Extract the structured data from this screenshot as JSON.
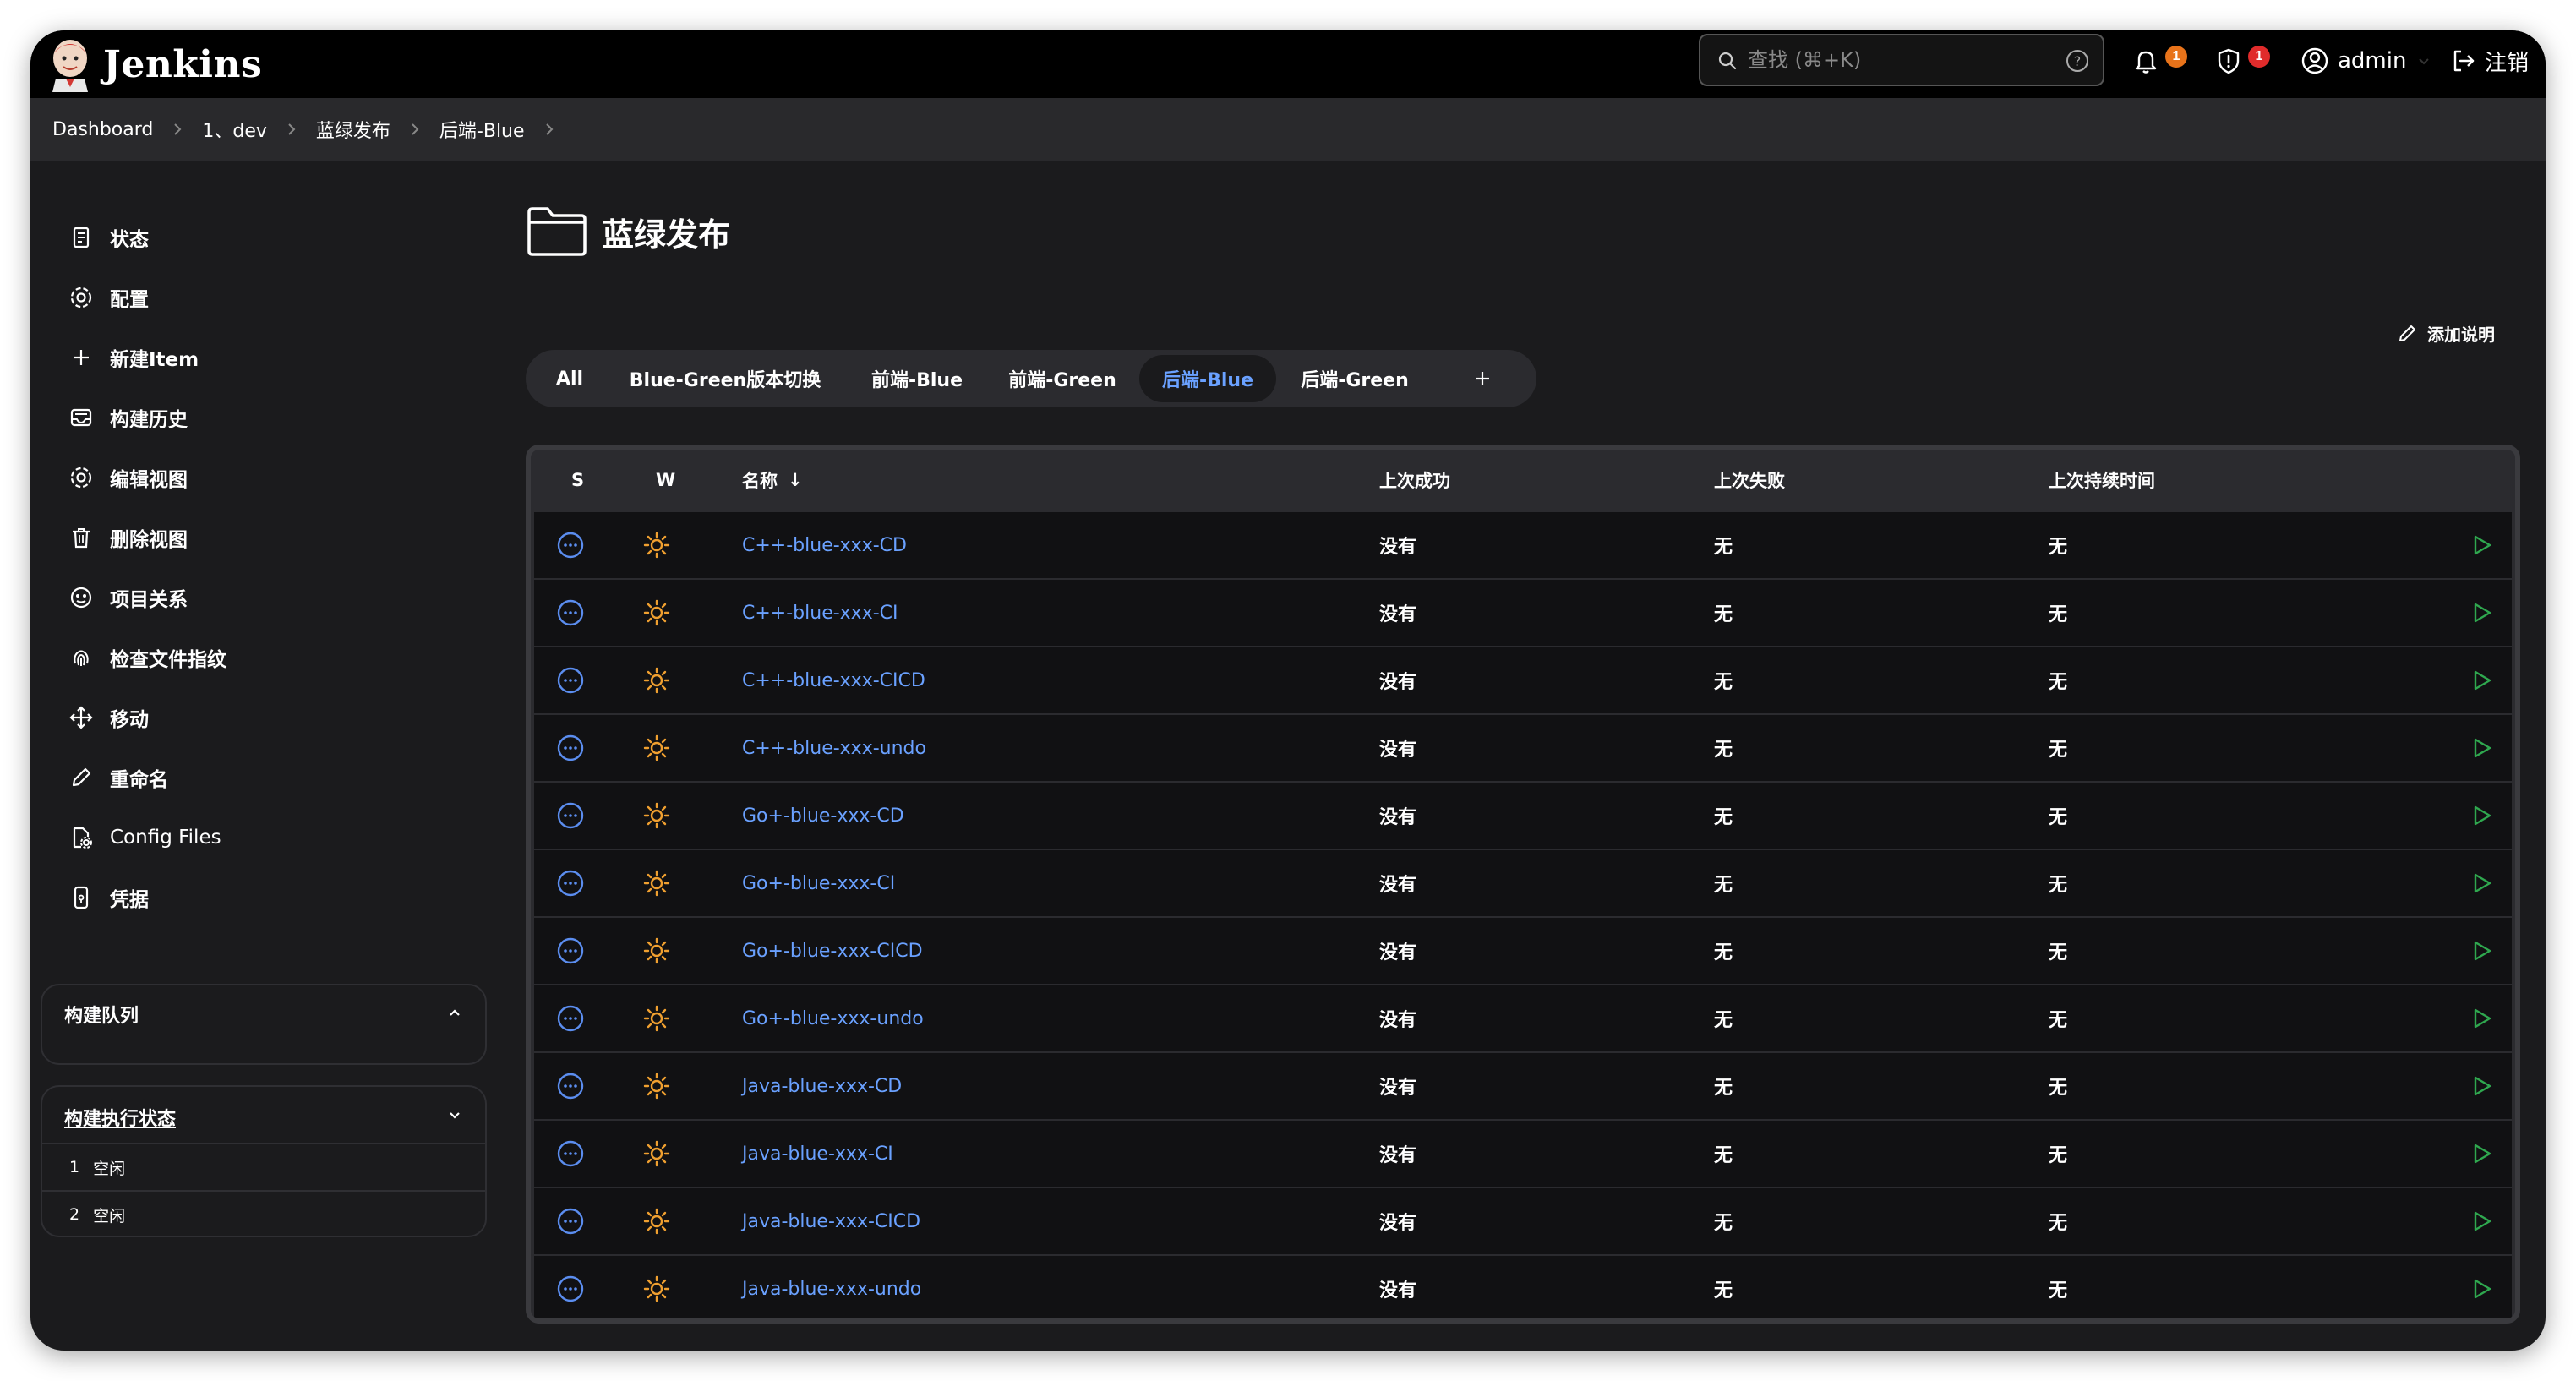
{
  "header": {
    "app_title": "Jenkins",
    "search_placeholder": "查找 (⌘+K)",
    "notifications_count": "1",
    "security_count": "1",
    "user": "admin",
    "logout": "注销",
    "colors": {
      "notif_badge": "#e8731a",
      "security_badge": "#e02b2b"
    }
  },
  "breadcrumb": [
    "Dashboard",
    "1、dev",
    "蓝绿发布",
    "后端-Blue"
  ],
  "sidebar": {
    "items": [
      {
        "label": "状态",
        "icon": "notepad-icon"
      },
      {
        "label": "配置",
        "icon": "gear-icon"
      },
      {
        "label": "新建Item",
        "icon": "plus-icon"
      },
      {
        "label": "构建历史",
        "icon": "inbox-icon"
      },
      {
        "label": "编辑视图",
        "icon": "gear-icon"
      },
      {
        "label": "删除视图",
        "icon": "trash-icon"
      },
      {
        "label": "项目关系",
        "icon": "relation-icon"
      },
      {
        "label": "检查文件指纹",
        "icon": "fingerprint-icon"
      },
      {
        "label": "移动",
        "icon": "move-icon"
      },
      {
        "label": "重命名",
        "icon": "pencil-icon"
      },
      {
        "label": "Config Files",
        "icon": "file-gear-icon"
      },
      {
        "label": "凭据",
        "icon": "phone-key-icon"
      }
    ],
    "build_queue": {
      "title": "构建队列"
    },
    "executors": {
      "title": "构建执行状态",
      "rows": [
        {
          "num": "1",
          "status": "空闲"
        },
        {
          "num": "2",
          "status": "空闲"
        }
      ]
    }
  },
  "main": {
    "title": "蓝绿发布",
    "add_description": "添加说明",
    "tabs": [
      {
        "label": "All",
        "active": false
      },
      {
        "label": "Blue-Green版本切换",
        "active": false
      },
      {
        "label": "前端-Blue",
        "active": false
      },
      {
        "label": "前端-Green",
        "active": false
      },
      {
        "label": "后端-Blue",
        "active": true
      },
      {
        "label": "后端-Green",
        "active": false
      }
    ],
    "table": {
      "columns": {
        "s": "S",
        "w": "W",
        "name": "名称",
        "name_sort": "↓",
        "last_success": "上次成功",
        "last_failure": "上次失败",
        "last_duration": "上次持续时间"
      },
      "rows": [
        {
          "name": "C++-blue-xxx-CD",
          "last_success": "没有",
          "last_failure": "无",
          "last_duration": "无"
        },
        {
          "name": "C++-blue-xxx-CI",
          "last_success": "没有",
          "last_failure": "无",
          "last_duration": "无"
        },
        {
          "name": "C++-blue-xxx-CICD",
          "last_success": "没有",
          "last_failure": "无",
          "last_duration": "无"
        },
        {
          "name": "C++-blue-xxx-undo",
          "last_success": "没有",
          "last_failure": "无",
          "last_duration": "无"
        },
        {
          "name": "Go+-blue-xxx-CD",
          "last_success": "没有",
          "last_failure": "无",
          "last_duration": "无"
        },
        {
          "name": "Go+-blue-xxx-CI",
          "last_success": "没有",
          "last_failure": "无",
          "last_duration": "无"
        },
        {
          "name": "Go+-blue-xxx-CICD",
          "last_success": "没有",
          "last_failure": "无",
          "last_duration": "无"
        },
        {
          "name": "Go+-blue-xxx-undo",
          "last_success": "没有",
          "last_failure": "无",
          "last_duration": "无"
        },
        {
          "name": "Java-blue-xxx-CD",
          "last_success": "没有",
          "last_failure": "无",
          "last_duration": "无"
        },
        {
          "name": "Java-blue-xxx-CI",
          "last_success": "没有",
          "last_failure": "无",
          "last_duration": "无"
        },
        {
          "name": "Java-blue-xxx-CICD",
          "last_success": "没有",
          "last_failure": "无",
          "last_duration": "无"
        },
        {
          "name": "Java-blue-xxx-undo",
          "last_success": "没有",
          "last_failure": "无",
          "last_duration": "无"
        }
      ]
    },
    "colors": {
      "link": "#6aa1ff",
      "status_icon": "#5b8def",
      "weather_icon": "#f0a030",
      "run_icon": "#2fa84f"
    }
  }
}
